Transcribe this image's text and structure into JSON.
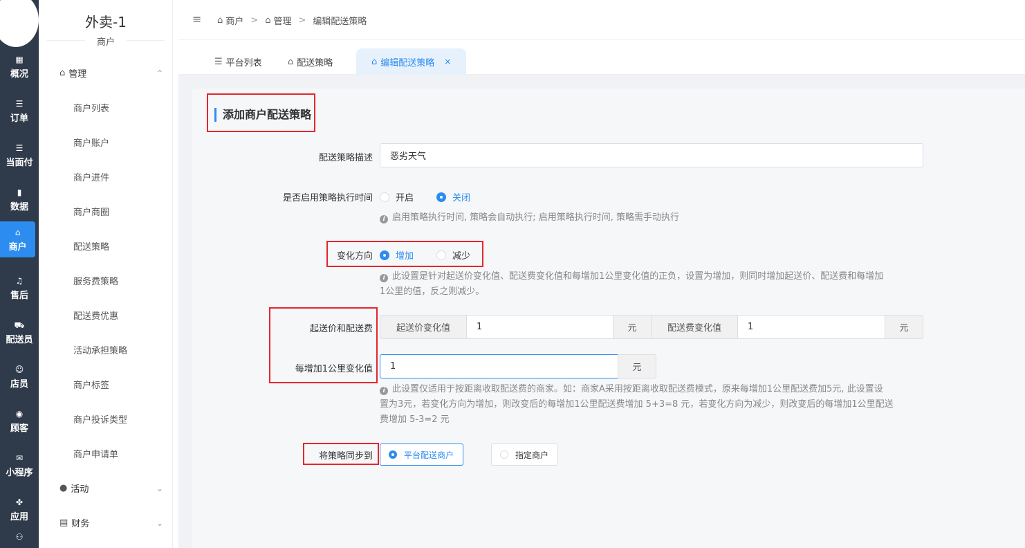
{
  "rail": {
    "items": [
      {
        "label": "概况",
        "icon": "▦"
      },
      {
        "label": "订单",
        "icon": "☰"
      },
      {
        "label": "当面付",
        "icon": "☰"
      },
      {
        "label": "数据",
        "icon": "▮"
      },
      {
        "label": "商户",
        "icon": "⌂"
      },
      {
        "label": "售后",
        "icon": "♫"
      },
      {
        "label": "配送员",
        "icon": "⛟"
      },
      {
        "label": "店员",
        "icon": "☺"
      },
      {
        "label": "顾客",
        "icon": "◉"
      },
      {
        "label": "小程序",
        "icon": "✉"
      },
      {
        "label": "应用",
        "icon": "✤"
      }
    ]
  },
  "sidebar": {
    "title": "外卖-1",
    "subtitle": "商户",
    "group_manage": "管理",
    "links": [
      "商户列表",
      "商户账户",
      "商户进件",
      "商户商圈",
      "配送策略",
      "服务费策略",
      "配送费优惠",
      "活动承担策略",
      "商户标签",
      "商户投诉类型",
      "商户申请单"
    ],
    "group_activity": "活动",
    "group_finance": "财务"
  },
  "breadcrumb": {
    "item1": "商户",
    "item2": "管理",
    "item3": "编辑配送策略",
    "separator": ">"
  },
  "tabs": [
    {
      "label": "平台列表"
    },
    {
      "label": "配送策略"
    },
    {
      "label": "编辑配送策略",
      "close": "×"
    }
  ],
  "form": {
    "section_title": "添加商户配送策略",
    "desc_label": "配送策略描述",
    "desc_value": "恶劣天气",
    "exec_time_label": "是否启用策略执行时间",
    "exec_time_on": "开启",
    "exec_time_off": "关闭",
    "exec_time_selected": "关闭",
    "exec_time_hint": "启用策略执行时间, 策略会自动执行; 启用策略执行时间, 策略需手动执行",
    "direction_label": "变化方向",
    "direction_inc": "增加",
    "direction_dec": "减少",
    "direction_selected": "增加",
    "direction_hint_1": "此设置是针对起送价变化值、配送费变化值和每增加1公里变化值的正负，设置为增加，则同时增加起送价、配送费和每增加",
    "direction_hint_2": "1公里的值，反之则减少。",
    "fee_label": "起送价和配送费",
    "min_price_addon": "起送价变化值",
    "min_price_value": "1",
    "min_price_unit": "元",
    "delivery_fee_addon": "配送费变化值",
    "delivery_fee_value": "1",
    "delivery_fee_unit": "元",
    "per_km_label": "每增加1公里变化值",
    "per_km_value": "1",
    "per_km_unit": "元",
    "per_km_hint_1": "此设置仅适用于按距离收取配送费的商家。如：商家A采用按距离收取配送费模式，原来每增加1公里配送费加5元, 此设置设",
    "per_km_hint_2": "置为3元，若变化方向为增加，则改变后的每增加1公里配送费增加 5+3=8 元，若变化方向为减少，则改变后的每增加1公里配送",
    "per_km_hint_3": "费增加 5-3=2 元",
    "sync_label": "将策略同步到",
    "sync_platform": "平台配送商户",
    "sync_specific": "指定商户",
    "sync_selected": "平台配送商户"
  },
  "colors": {
    "accent": "#2d8cf0",
    "rail_bg": "#2f3a4a",
    "highlight_box": "#e5262d"
  }
}
